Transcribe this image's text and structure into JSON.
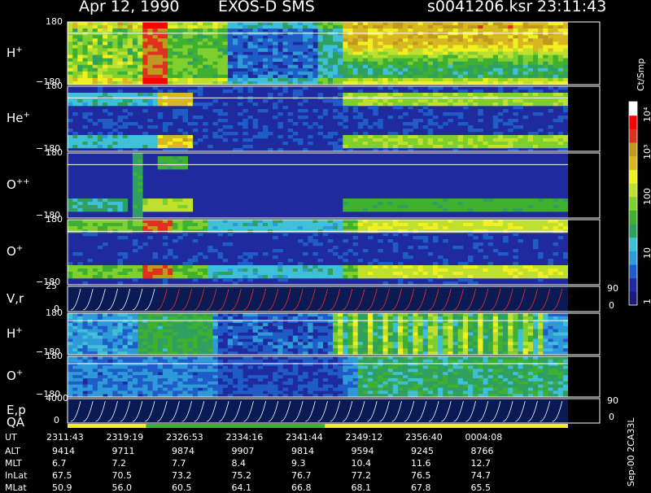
{
  "header": {
    "date": "Apr 12, 1990",
    "mission": "EXOS-D SMS",
    "file": "s0041206.ksr",
    "time": "23:11:43"
  },
  "chart_data": {
    "type": "heatmap",
    "panels": [
      {
        "species": "H",
        "charge": "+",
        "ymax": "180",
        "ymin": "−180"
      },
      {
        "species": "He",
        "charge": "+",
        "ymax": "180",
        "ymin": "−180"
      },
      {
        "species": "O",
        "charge": "++",
        "ymax": "180",
        "ymin": "−180"
      },
      {
        "species": "O",
        "charge": "+",
        "ymax": "180",
        "ymin": "−180"
      },
      {
        "species": "V,r",
        "charge": "",
        "ymax": "25",
        "ymin": "0",
        "right_max": "90",
        "right_min": "0"
      },
      {
        "species": "H",
        "charge": "+",
        "ymax": "180",
        "ymin": "−180"
      },
      {
        "species": "O",
        "charge": "+",
        "ymax": "180",
        "ymin": "−180"
      },
      {
        "species": "E,p",
        "charge": "",
        "ymax": "4000",
        "ymin": "0",
        "right_max": "90",
        "right_min": "0"
      }
    ],
    "qa_label": "QA",
    "colorbar": {
      "unit": "Ct/Smp",
      "ticks": [
        "10⁴",
        "10³",
        "100",
        "10",
        "1"
      ],
      "colors": [
        "#1a1a7a",
        "#1f2a9e",
        "#1f5cc8",
        "#2f9ad8",
        "#3fc0d8",
        "#2fa060",
        "#3fb030",
        "#7fd02f",
        "#c0e02f",
        "#f0f020",
        "#d8b820",
        "#c09a20",
        "#e03020",
        "#ff0000",
        "#ffffff"
      ]
    },
    "ut_labels": [
      "UT",
      "2311:43",
      "2319:19",
      "2326:53",
      "2334:16",
      "2341:44",
      "2349:12",
      "2356:40",
      "0004:08"
    ],
    "rows": [
      {
        "label": "ALT",
        "values": [
          "9414",
          "9711",
          "9874",
          "9907",
          "9814",
          "9594",
          "9245",
          "8766"
        ]
      },
      {
        "label": "MLT",
        "values": [
          "6.7",
          "7.2",
          "7.7",
          "8.4",
          "9.3",
          "10.4",
          "11.6",
          "12.7"
        ]
      },
      {
        "label": "InLat",
        "values": [
          "67.5",
          "70.5",
          "73.2",
          "75.2",
          "76.7",
          "77.2",
          "76.5",
          "74.7"
        ]
      },
      {
        "label": "MLat",
        "values": [
          "50.9",
          "56.0",
          "60.5",
          "64.1",
          "66.8",
          "68.1",
          "67.8",
          "65.5"
        ]
      }
    ],
    "qa_bar": [
      {
        "from": 0.0,
        "to": 0.157,
        "color": "#f0f020"
      },
      {
        "from": 0.157,
        "to": 0.514,
        "color": "#3fb030"
      },
      {
        "from": 0.514,
        "to": 1.0,
        "color": "#f0f020"
      }
    ],
    "side_note": "Sep-00 2CA33L",
    "background_color": "#1f2a9e"
  }
}
